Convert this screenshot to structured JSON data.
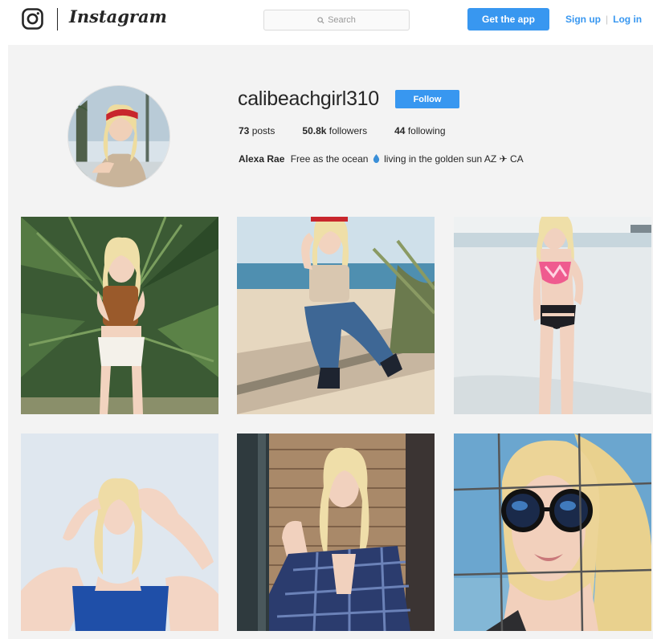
{
  "topbar": {
    "brand": "Instagram",
    "search_placeholder": "Search",
    "get_app_label": "Get the app",
    "signup_label": "Sign up",
    "separator": "|",
    "login_label": "Log in",
    "accent_color": "#3897f0"
  },
  "profile": {
    "username": "calibeachgirl310",
    "follow_label": "Follow",
    "posts_count": "73",
    "posts_label": "posts",
    "followers_count": "50.8k",
    "followers_label": "followers",
    "following_count": "44",
    "following_label": "following",
    "full_name": "Alexa Rae",
    "bio_part1": "Free as the ocean",
    "bio_part2": "living in the golden sun AZ ✈ CA"
  },
  "posts": [
    {
      "subject": "palm-tree-portrait"
    },
    {
      "subject": "beach-fence-portrait"
    },
    {
      "subject": "beach-bikini-portrait"
    },
    {
      "subject": "white-wall-portrait"
    },
    {
      "subject": "brick-wall-portrait"
    },
    {
      "subject": "sunglasses-fence-portrait"
    }
  ]
}
